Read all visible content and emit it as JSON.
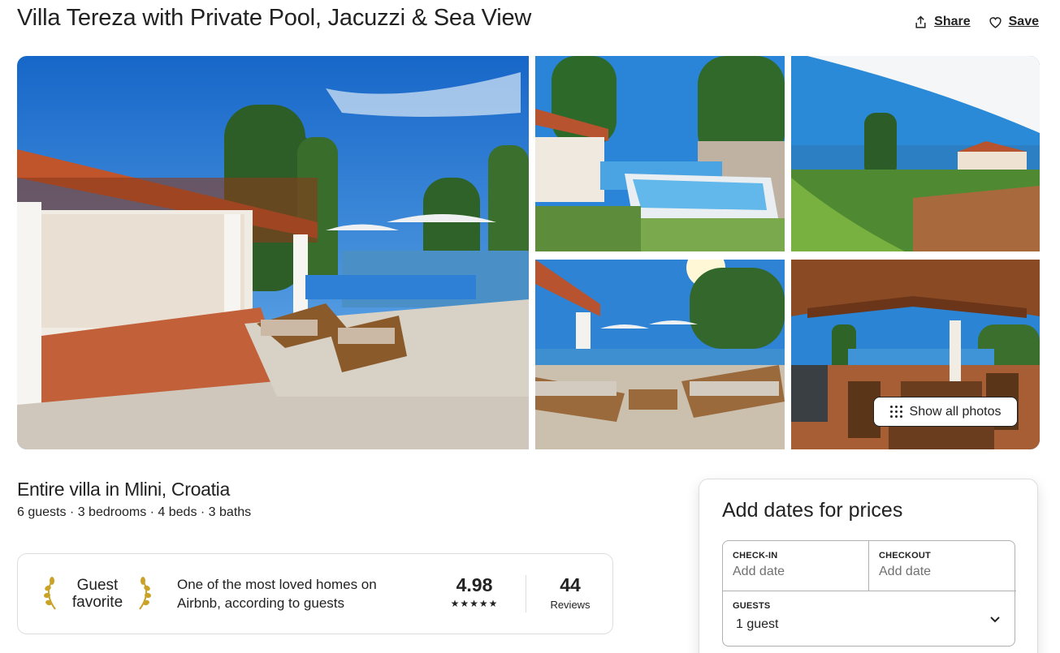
{
  "listing": {
    "title": "Villa Tereza with Private Pool, Jacuzzi & Sea View",
    "type": "Entire villa in Mlini, Croatia",
    "meta": "6 guests · 3 bedrooms · 4 beds · 3 baths"
  },
  "actions": {
    "share_label": "Share",
    "share_icon": "share-icon",
    "save_label": "Save",
    "save_icon": "heart-icon"
  },
  "gallery": {
    "photos": [
      "villa-terrace-pool",
      "jacuzzi-patio",
      "sea-view-balcony",
      "sunbeds-terrace",
      "covered-dining-pergola"
    ],
    "show_all_label": "Show all photos",
    "show_all_icon": "grid-dots-icon"
  },
  "guest_favorite": {
    "badge_line1": "Guest",
    "badge_line2": "favorite",
    "badge_icon": "laurel-icon",
    "description": "One of the most loved homes on Airbnb, according to guests",
    "rating": "4.98",
    "stars": "★★★★★",
    "reviews_count": "44",
    "reviews_label": "Reviews"
  },
  "booking": {
    "title": "Add dates for prices",
    "checkin_label": "CHECK-IN",
    "checkin_placeholder": "Add date",
    "checkout_label": "CHECKOUT",
    "checkout_placeholder": "Add date",
    "guests_label": "GUESTS",
    "guests_value": "1 guest",
    "guests_icon": "chevron-down-icon"
  },
  "colors": {
    "text": "#222222",
    "muted": "#717171",
    "border": "#dddddd",
    "sky": "#2f86d6",
    "pool": "#3a8fd0",
    "roof": "#c0552b"
  }
}
